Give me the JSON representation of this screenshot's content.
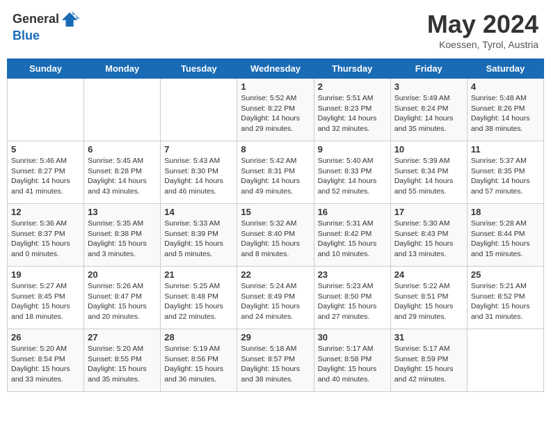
{
  "header": {
    "logo_general": "General",
    "logo_blue": "Blue",
    "title": "May 2024",
    "subtitle": "Koessen, Tyrol, Austria"
  },
  "days_of_week": [
    "Sunday",
    "Monday",
    "Tuesday",
    "Wednesday",
    "Thursday",
    "Friday",
    "Saturday"
  ],
  "weeks": [
    [
      {
        "day": "",
        "info": ""
      },
      {
        "day": "",
        "info": ""
      },
      {
        "day": "",
        "info": ""
      },
      {
        "day": "1",
        "info": "Sunrise: 5:52 AM\nSunset: 8:22 PM\nDaylight: 14 hours\nand 29 minutes."
      },
      {
        "day": "2",
        "info": "Sunrise: 5:51 AM\nSunset: 8:23 PM\nDaylight: 14 hours\nand 32 minutes."
      },
      {
        "day": "3",
        "info": "Sunrise: 5:49 AM\nSunset: 8:24 PM\nDaylight: 14 hours\nand 35 minutes."
      },
      {
        "day": "4",
        "info": "Sunrise: 5:48 AM\nSunset: 8:26 PM\nDaylight: 14 hours\nand 38 minutes."
      }
    ],
    [
      {
        "day": "5",
        "info": "Sunrise: 5:46 AM\nSunset: 8:27 PM\nDaylight: 14 hours\nand 41 minutes."
      },
      {
        "day": "6",
        "info": "Sunrise: 5:45 AM\nSunset: 8:28 PM\nDaylight: 14 hours\nand 43 minutes."
      },
      {
        "day": "7",
        "info": "Sunrise: 5:43 AM\nSunset: 8:30 PM\nDaylight: 14 hours\nand 46 minutes."
      },
      {
        "day": "8",
        "info": "Sunrise: 5:42 AM\nSunset: 8:31 PM\nDaylight: 14 hours\nand 49 minutes."
      },
      {
        "day": "9",
        "info": "Sunrise: 5:40 AM\nSunset: 8:33 PM\nDaylight: 14 hours\nand 52 minutes."
      },
      {
        "day": "10",
        "info": "Sunrise: 5:39 AM\nSunset: 8:34 PM\nDaylight: 14 hours\nand 55 minutes."
      },
      {
        "day": "11",
        "info": "Sunrise: 5:37 AM\nSunset: 8:35 PM\nDaylight: 14 hours\nand 57 minutes."
      }
    ],
    [
      {
        "day": "12",
        "info": "Sunrise: 5:36 AM\nSunset: 8:37 PM\nDaylight: 15 hours\nand 0 minutes."
      },
      {
        "day": "13",
        "info": "Sunrise: 5:35 AM\nSunset: 8:38 PM\nDaylight: 15 hours\nand 3 minutes."
      },
      {
        "day": "14",
        "info": "Sunrise: 5:33 AM\nSunset: 8:39 PM\nDaylight: 15 hours\nand 5 minutes."
      },
      {
        "day": "15",
        "info": "Sunrise: 5:32 AM\nSunset: 8:40 PM\nDaylight: 15 hours\nand 8 minutes."
      },
      {
        "day": "16",
        "info": "Sunrise: 5:31 AM\nSunset: 8:42 PM\nDaylight: 15 hours\nand 10 minutes."
      },
      {
        "day": "17",
        "info": "Sunrise: 5:30 AM\nSunset: 8:43 PM\nDaylight: 15 hours\nand 13 minutes."
      },
      {
        "day": "18",
        "info": "Sunrise: 5:28 AM\nSunset: 8:44 PM\nDaylight: 15 hours\nand 15 minutes."
      }
    ],
    [
      {
        "day": "19",
        "info": "Sunrise: 5:27 AM\nSunset: 8:45 PM\nDaylight: 15 hours\nand 18 minutes."
      },
      {
        "day": "20",
        "info": "Sunrise: 5:26 AM\nSunset: 8:47 PM\nDaylight: 15 hours\nand 20 minutes."
      },
      {
        "day": "21",
        "info": "Sunrise: 5:25 AM\nSunset: 8:48 PM\nDaylight: 15 hours\nand 22 minutes."
      },
      {
        "day": "22",
        "info": "Sunrise: 5:24 AM\nSunset: 8:49 PM\nDaylight: 15 hours\nand 24 minutes."
      },
      {
        "day": "23",
        "info": "Sunrise: 5:23 AM\nSunset: 8:50 PM\nDaylight: 15 hours\nand 27 minutes."
      },
      {
        "day": "24",
        "info": "Sunrise: 5:22 AM\nSunset: 8:51 PM\nDaylight: 15 hours\nand 29 minutes."
      },
      {
        "day": "25",
        "info": "Sunrise: 5:21 AM\nSunset: 8:52 PM\nDaylight: 15 hours\nand 31 minutes."
      }
    ],
    [
      {
        "day": "26",
        "info": "Sunrise: 5:20 AM\nSunset: 8:54 PM\nDaylight: 15 hours\nand 33 minutes."
      },
      {
        "day": "27",
        "info": "Sunrise: 5:20 AM\nSunset: 8:55 PM\nDaylight: 15 hours\nand 35 minutes."
      },
      {
        "day": "28",
        "info": "Sunrise: 5:19 AM\nSunset: 8:56 PM\nDaylight: 15 hours\nand 36 minutes."
      },
      {
        "day": "29",
        "info": "Sunrise: 5:18 AM\nSunset: 8:57 PM\nDaylight: 15 hours\nand 38 minutes."
      },
      {
        "day": "30",
        "info": "Sunrise: 5:17 AM\nSunset: 8:58 PM\nDaylight: 15 hours\nand 40 minutes."
      },
      {
        "day": "31",
        "info": "Sunrise: 5:17 AM\nSunset: 8:59 PM\nDaylight: 15 hours\nand 42 minutes."
      },
      {
        "day": "",
        "info": ""
      }
    ]
  ]
}
